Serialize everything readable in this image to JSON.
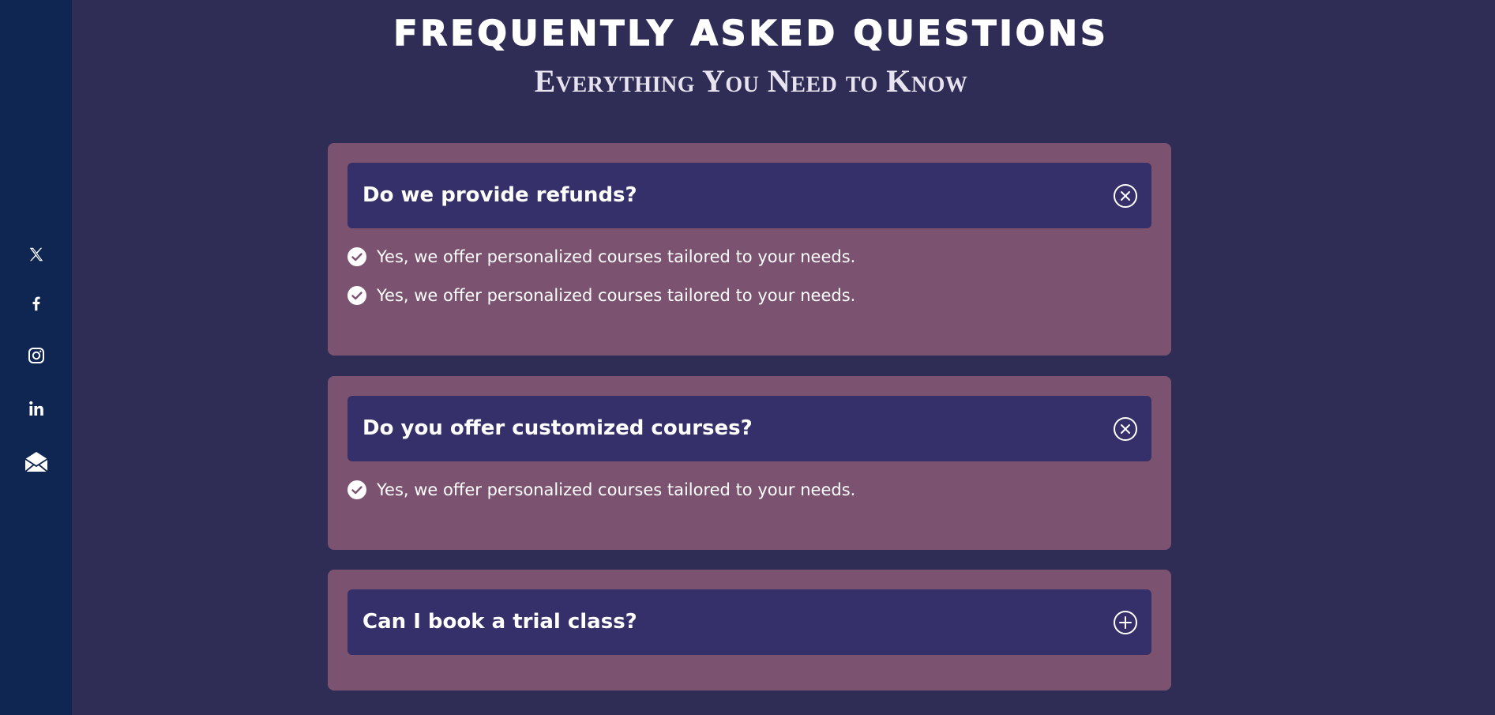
{
  "sidebar": {
    "social": [
      {
        "name": "x-icon"
      },
      {
        "name": "facebook-icon"
      },
      {
        "name": "instagram-icon"
      },
      {
        "name": "linkedin-icon"
      },
      {
        "name": "email-icon"
      }
    ]
  },
  "header": {
    "title": "FREQUENTLY ASKED QUESTIONS",
    "subtitle": "Everything You Need to Know"
  },
  "faqs": [
    {
      "question": "Do we provide refunds?",
      "expanded": true,
      "toggle_icon": "close-circle-icon",
      "answers": [
        "Yes, we offer personalized courses tailored to your needs.",
        "Yes, we offer personalized courses tailored to your needs."
      ]
    },
    {
      "question": "Do you offer customized courses?",
      "expanded": true,
      "toggle_icon": "close-circle-icon",
      "answers": [
        "Yes, we offer personalized courses tailored to your needs."
      ]
    },
    {
      "question": "Can I book a trial class?",
      "expanded": false,
      "toggle_icon": "plus-circle-icon",
      "answers": []
    }
  ],
  "colors": {
    "background": "#2f2c56",
    "sidebar": "#0f2653",
    "card": "#7b5370",
    "question_bar": "#36306a",
    "text": "#ffffff"
  }
}
